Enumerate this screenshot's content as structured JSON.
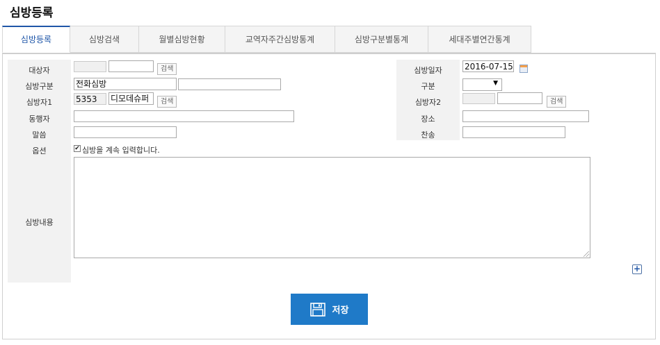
{
  "page": {
    "title": "심방등록"
  },
  "tabs": [
    {
      "label": "심방등록",
      "active": true
    },
    {
      "label": "심방검색"
    },
    {
      "label": "월별심방현황"
    },
    {
      "label": "교역자주간심방통계"
    },
    {
      "label": "심방구분별통계"
    },
    {
      "label": "세대주별연간통계"
    }
  ],
  "form": {
    "target_label": "대상자",
    "target_search": "검색",
    "visit_type_label": "심방구분",
    "visit_type_value": "전화심방",
    "visitor1_label": "심방자1",
    "visitor1_code": "5353",
    "visitor1_name": "디모데슈퍼",
    "visitor1_search": "검색",
    "companion_label": "동행자",
    "scripture_label": "말씀",
    "option_label": "옵션",
    "option_checkbox_text": "심방을 계속 입력합니다.",
    "option_checked": true,
    "content_label": "심방내용",
    "visit_date_label": "심방일자",
    "visit_date_value": "2016-07-15",
    "division_label": "구분",
    "visitor2_label": "심방자2",
    "visitor2_search": "검색",
    "place_label": "장소",
    "hymn_label": "찬송"
  },
  "actions": {
    "save_label": "저장"
  },
  "colors": {
    "accent": "#1f56a8",
    "save_button": "#1f7ac8"
  },
  "icons": {
    "calendar": "calendar-icon",
    "save": "floppy-disk-icon",
    "add": "plus-icon"
  }
}
